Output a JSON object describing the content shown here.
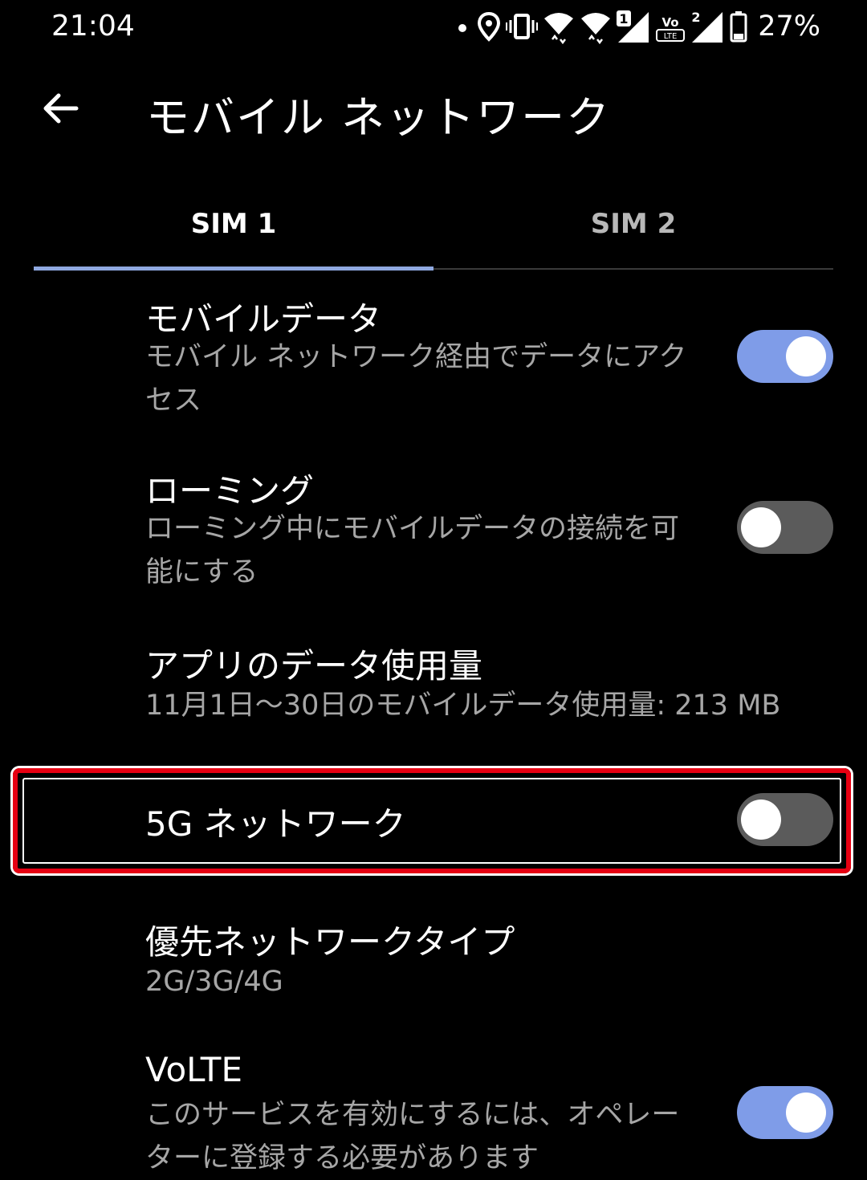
{
  "status_bar": {
    "time": "21:04",
    "icons": [
      "dot-icon",
      "location-icon",
      "vibrate-icon",
      "wifi-calling-icon",
      "wifi-calling-icon",
      "signal-sim1-icon",
      "volte-icon",
      "signal-sim2-icon",
      "battery-icon"
    ],
    "sim1_badge": "1",
    "sim2_badge": "2",
    "volte_top": "Vo",
    "volte_bottom": "LTE",
    "battery": "27%"
  },
  "header": {
    "title": "モバイル ネットワーク"
  },
  "tabs": [
    {
      "label": "SIM 1",
      "selected": true
    },
    {
      "label": "SIM 2",
      "selected": false
    }
  ],
  "settings": {
    "mobile_data": {
      "title": "モバイルデータ",
      "subtitle": "モバイル ネットワーク経由でデータにアクセス",
      "enabled": true
    },
    "roaming": {
      "title": "ローミング",
      "subtitle": "ローミング中にモバイルデータの接続を可能にする",
      "enabled": false
    },
    "app_data_usage": {
      "title": "アプリのデータ使用量",
      "subtitle": "11月1日〜30日のモバイルデータ使用量: 213 MB"
    },
    "network_5g": {
      "title": "5G ネットワーク",
      "enabled": false
    },
    "preferred_network": {
      "title": "優先ネットワークタイプ",
      "subtitle": "2G/3G/4G"
    },
    "volte": {
      "title": "VoLTE",
      "subtitle": "このサービスを有効にするには、オペレーターに登録する必要があります",
      "enabled": true
    }
  },
  "colors": {
    "background": "#000000",
    "accent": "#7f9ce8",
    "highlight_frame": "#e60012",
    "secondary_text": "#a6a6a6"
  }
}
